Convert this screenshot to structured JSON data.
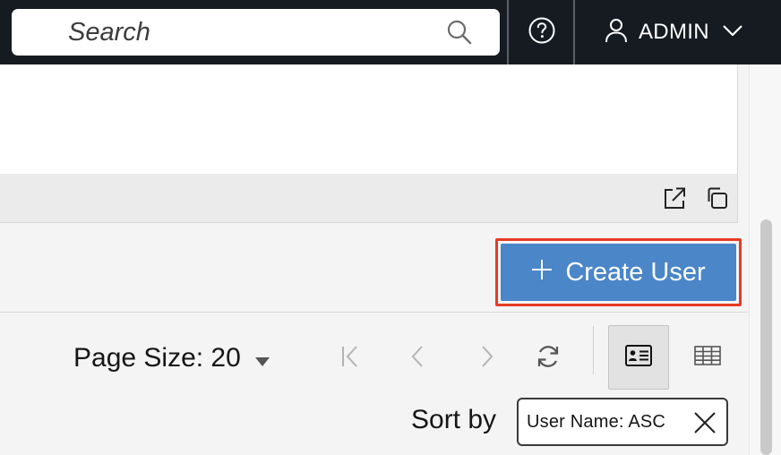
{
  "header": {
    "search": {
      "placeholder": "Search",
      "icon": "search-icon"
    },
    "help": {
      "icon": "help-icon"
    },
    "user": {
      "name": "ADMIN",
      "icon": "user-icon",
      "menu_icon": "chevron-down-icon"
    }
  },
  "card": {
    "footer_actions": [
      {
        "icon": "open-external-icon"
      },
      {
        "icon": "copy-icon"
      }
    ]
  },
  "actions": {
    "create_user": {
      "label": "Create User",
      "icon": "plus-icon",
      "color": "#4a86c8",
      "highlight_color": "#e63b25"
    }
  },
  "toolbar": {
    "page_size_label": "Page Size: 20",
    "pagination": [
      "first-page-icon",
      "previous-page-icon",
      "next-page-icon",
      "refresh-icon"
    ],
    "views": [
      {
        "icon": "card-view-icon",
        "selected": true
      },
      {
        "icon": "table-view-icon",
        "selected": false
      }
    ]
  },
  "sort": {
    "label": "Sort by",
    "chip_text": "User Name: ASC",
    "chip_close_icon": "close-icon"
  }
}
